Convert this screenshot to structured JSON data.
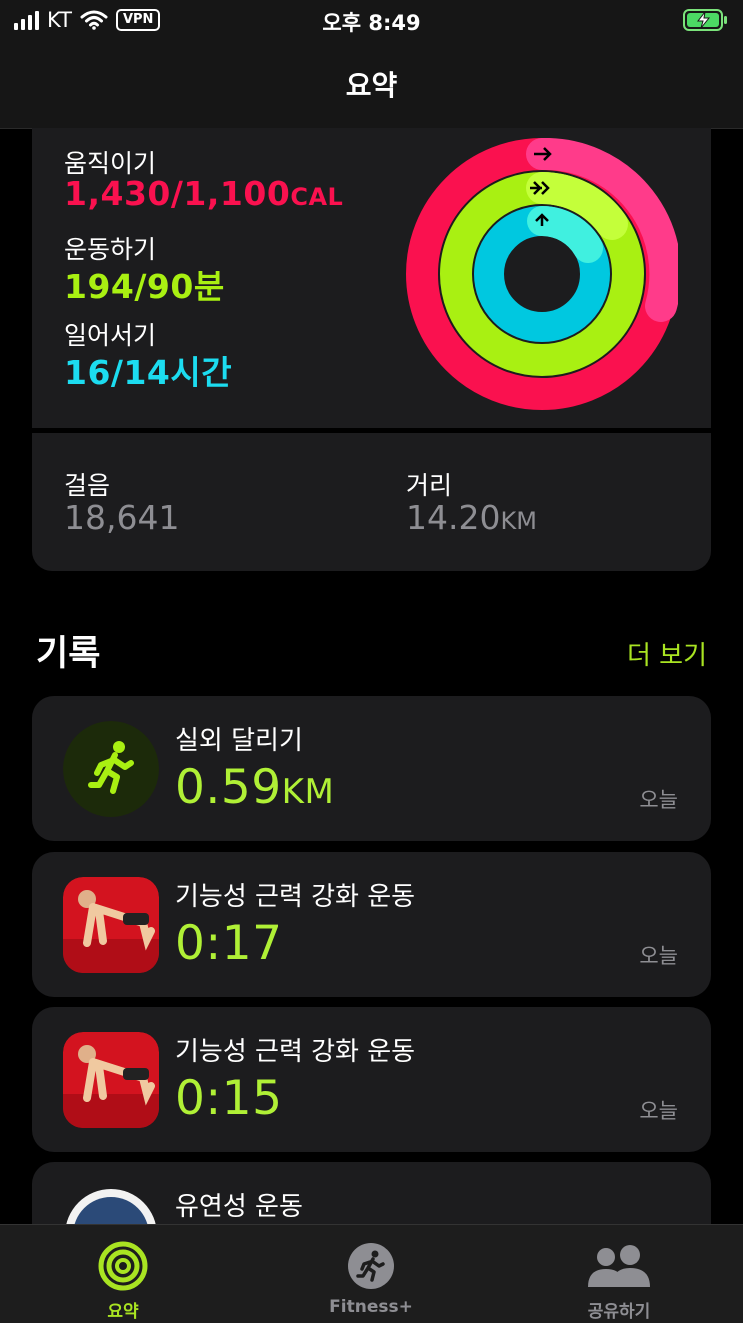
{
  "status_bar": {
    "carrier": "KT",
    "vpn": "VPN",
    "time": "오후 8:49"
  },
  "nav": {
    "title": "요약"
  },
  "activity": {
    "move": {
      "label": "움직이기",
      "value": "1,430/1,100",
      "unit": "CAL",
      "color": "#fa114f",
      "progress": 1.3
    },
    "exercise": {
      "label": "운동하기",
      "value": "194/90",
      "unit": "분",
      "color": "#a9f012",
      "progress": 2.16
    },
    "stand": {
      "label": "일어서기",
      "value": "16/14",
      "unit": "시간",
      "color": "#00d2e6",
      "progress": 1.14
    }
  },
  "stats": {
    "steps": {
      "label": "걸음",
      "value": "18,641"
    },
    "distance": {
      "label": "거리",
      "value": "14.20",
      "unit": "KM"
    }
  },
  "history": {
    "title": "기록",
    "more": "더 보기",
    "items": [
      {
        "name": "실외 달리기",
        "value": "0.59",
        "unit": "KM",
        "date": "오늘",
        "icon": "running-icon"
      },
      {
        "name": "기능성 근력 강화 운동",
        "value": "0:17",
        "unit": "",
        "date": "오늘",
        "icon": "pushup-app-icon"
      },
      {
        "name": "기능성 근력 강화 운동",
        "value": "0:15",
        "unit": "",
        "date": "오늘",
        "icon": "pushup-app-icon"
      },
      {
        "name": "유연성 운동",
        "value": "",
        "unit": "",
        "date": "",
        "icon": "flexibility-app-icon"
      }
    ]
  },
  "tabbar": {
    "tabs": [
      {
        "label": "요약",
        "active": true
      },
      {
        "label": "Fitness+",
        "active": false
      },
      {
        "label": "공유하기",
        "active": false
      }
    ]
  },
  "colors": {
    "accent": "#a9e422",
    "card": "#1c1c1e"
  }
}
